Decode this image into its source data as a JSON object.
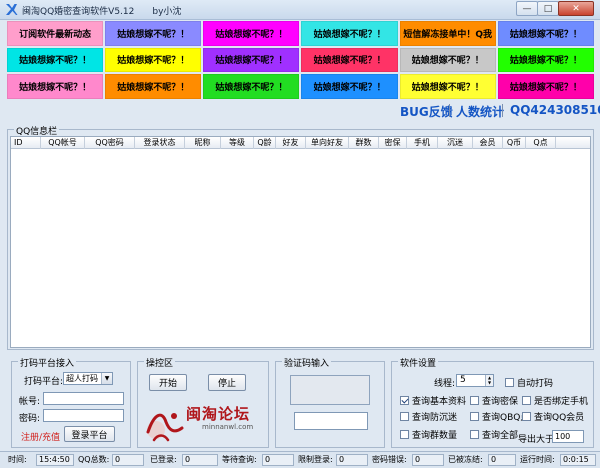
{
  "window": {
    "title": "闽淘QQ婚密查询软件V5.12",
    "author": "by小沈",
    "buttons": {
      "minimize": "—",
      "maximize": "□",
      "close": "✕"
    }
  },
  "links": [
    {
      "label": "订阅软件最新动态",
      "bg": "#ff9ecb",
      "fg": "#000000"
    },
    {
      "label": "姑娘想嫁不呢？！",
      "bg": "#8a8aff",
      "fg": "#000000"
    },
    {
      "label": "姑娘想嫁不呢？！",
      "bg": "#ff00ff",
      "fg": "#000000"
    },
    {
      "label": "姑娘想嫁不呢？！",
      "bg": "#33e5e5",
      "fg": "#000000"
    },
    {
      "label": "短信解冻接单中！Q我",
      "bg": "#ff8c00",
      "fg": "#000000"
    },
    {
      "label": "姑娘想嫁不呢？！",
      "bg": "#6f8cff",
      "fg": "#000000"
    },
    {
      "label": "姑娘想嫁不呢？！",
      "bg": "#00e5e5",
      "fg": "#000000"
    },
    {
      "label": "姑娘想嫁不呢？！",
      "bg": "#ffff00",
      "fg": "#000000"
    },
    {
      "label": "姑娘想嫁不呢？！",
      "bg": "#a030ff",
      "fg": "#000000"
    },
    {
      "label": "姑娘想嫁不呢？！",
      "bg": "#ff3366",
      "fg": "#000000"
    },
    {
      "label": "姑娘想嫁不呢？！",
      "bg": "#c8c8c8",
      "fg": "#000000"
    },
    {
      "label": "姑娘想嫁不呢？！",
      "bg": "#22ff00",
      "fg": "#000000"
    },
    {
      "label": "姑娘想嫁不呢？！",
      "bg": "#ff88cc",
      "fg": "#000000"
    },
    {
      "label": "姑娘想嫁不呢？！",
      "bg": "#ff8c00",
      "fg": "#000000"
    },
    {
      "label": "姑娘想嫁不呢？！",
      "bg": "#22dd22",
      "fg": "#000000"
    },
    {
      "label": "姑娘想嫁不呢？！",
      "bg": "#1e90ff",
      "fg": "#000000"
    },
    {
      "label": "姑娘想嫁不呢？！",
      "bg": "#ffff33",
      "fg": "#000000"
    },
    {
      "label": "姑娘想嫁不呢？！",
      "bg": "#ff00aa",
      "fg": "#000000"
    }
  ],
  "stats": {
    "bug": "BUG反馈",
    "count": "人数统计",
    "qq": "QQ424308510",
    "color": "#1455c4"
  },
  "info": {
    "legend": "QQ信息栏",
    "columns": [
      "ID",
      "QQ帐号",
      "QQ密码",
      "登录状态",
      "昵称",
      "等级",
      "Q龄",
      "好友",
      "单向好友",
      "群数",
      "密保",
      "手机",
      "沉迷",
      "会员",
      "Q币",
      "Q点"
    ]
  },
  "login": {
    "legend": "打码平台接入",
    "platform_label": "打码平台:",
    "platform_value": "超人打码",
    "account_label": "帐号:",
    "password_label": "密码:",
    "register": "注册/充值",
    "login_button": "登录平台"
  },
  "control": {
    "legend": "操控区",
    "start": "开始",
    "stop": "停止",
    "logo_text": "闽淘论坛",
    "logo_url": "minnanwl.com"
  },
  "captcha": {
    "legend": "验证码输入"
  },
  "settings": {
    "legend": "软件设置",
    "threads_label": "线程:",
    "threads_value": "5",
    "auto_captcha": "自动打码",
    "options": [
      {
        "label": "查询基本资料",
        "checked": true
      },
      {
        "label": "查询密保",
        "checked": false
      },
      {
        "label": "是否绑定手机",
        "checked": false
      },
      {
        "label": "查询防沉迷",
        "checked": false
      },
      {
        "label": "查询QBQ点",
        "checked": false
      },
      {
        "label": "查询QQ会员",
        "checked": false
      },
      {
        "label": "查询群数量",
        "checked": false
      },
      {
        "label": "查询全部",
        "checked": false
      }
    ],
    "export_label": "导出大于:",
    "export_value": "100"
  },
  "status": {
    "time_label": "时间:",
    "time_value": "15:4:50",
    "qq_total_label": "QQ总数:",
    "qq_total_value": "0",
    "logged_label": "已登录:",
    "logged_value": "0",
    "waiting_label": "等待查询:",
    "waiting_value": "0",
    "limited_label": "限制登录:",
    "limited_value": "0",
    "captcha_err_label": "密码错误:",
    "captcha_err_value": "0",
    "frozen_label": "已被冻结:",
    "frozen_value": "0",
    "runtime_label": "运行时间:",
    "runtime_value": "0:0:15"
  }
}
